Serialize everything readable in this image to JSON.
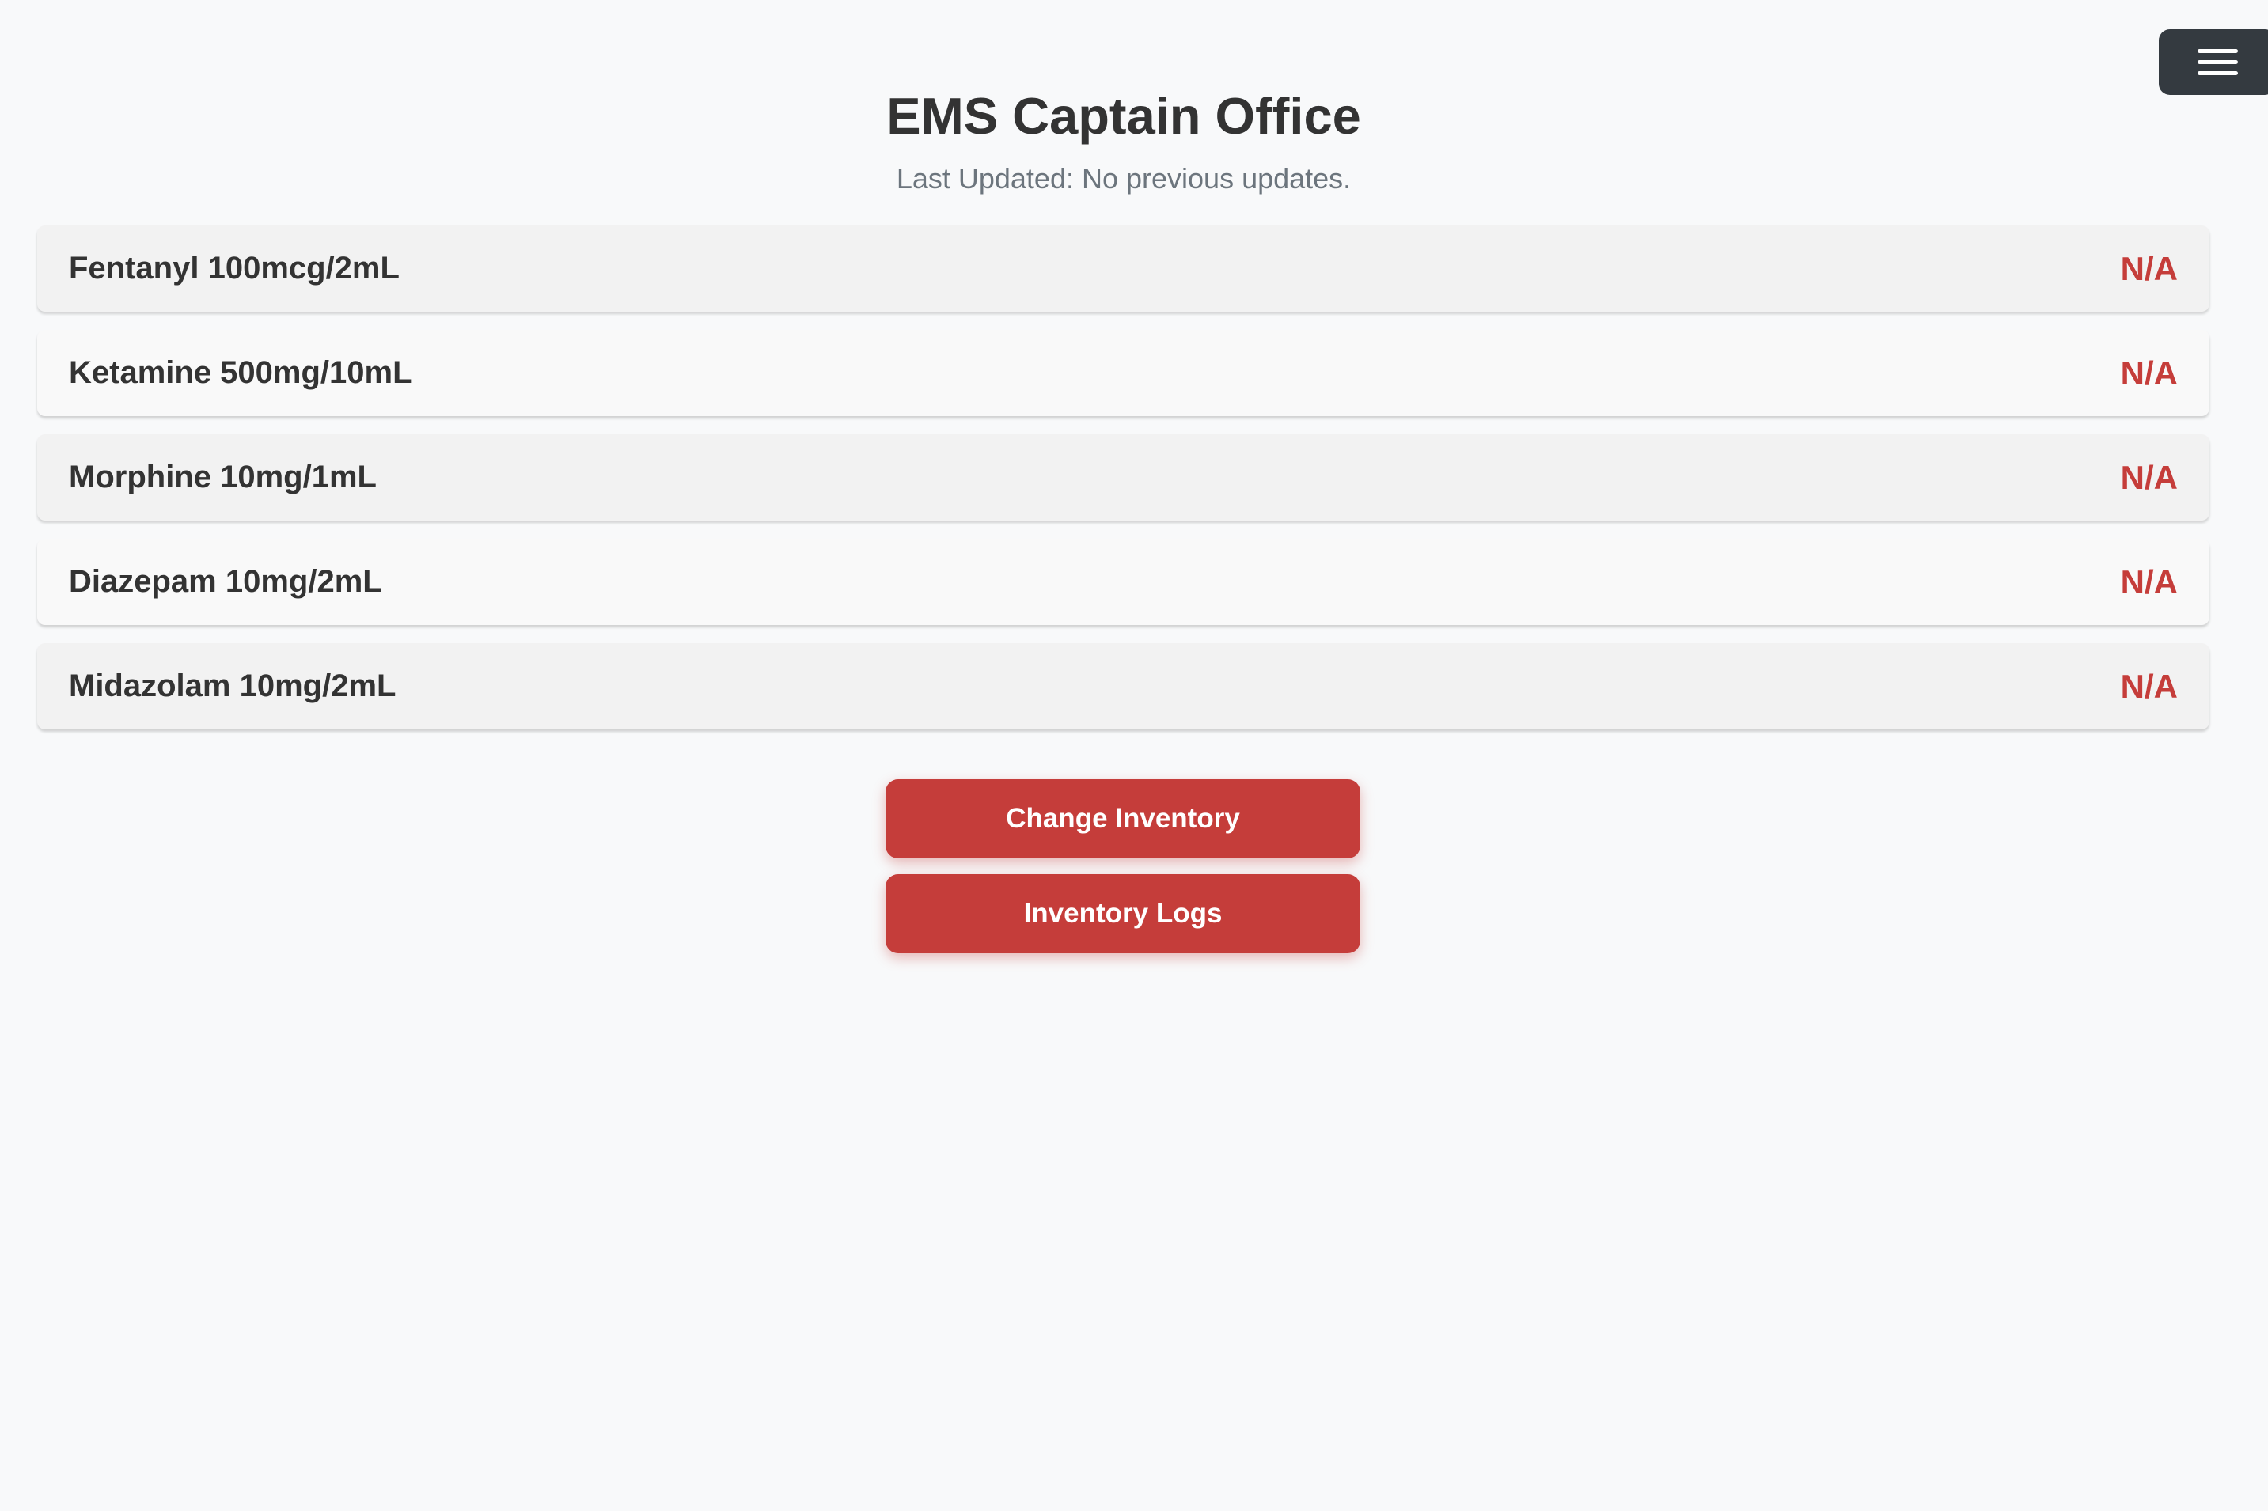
{
  "header": {
    "title": "EMS Captain Office",
    "last_updated": "Last Updated: No previous updates."
  },
  "menu": {
    "icon": "hamburger-menu-icon"
  },
  "medications": [
    {
      "name": "Fentanyl 100mcg/2mL",
      "count": "N/A"
    },
    {
      "name": "Ketamine 500mg/10mL",
      "count": "N/A"
    },
    {
      "name": "Morphine 10mg/1mL",
      "count": "N/A"
    },
    {
      "name": "Diazepam 10mg/2mL",
      "count": "N/A"
    },
    {
      "name": "Midazolam 10mg/2mL",
      "count": "N/A"
    }
  ],
  "actions": {
    "change_inventory_label": "Change Inventory",
    "inventory_logs_label": "Inventory Logs"
  },
  "colors": {
    "accent": "#c53d3a",
    "menu_button": "#343a40",
    "background": "#f8f9fa"
  }
}
